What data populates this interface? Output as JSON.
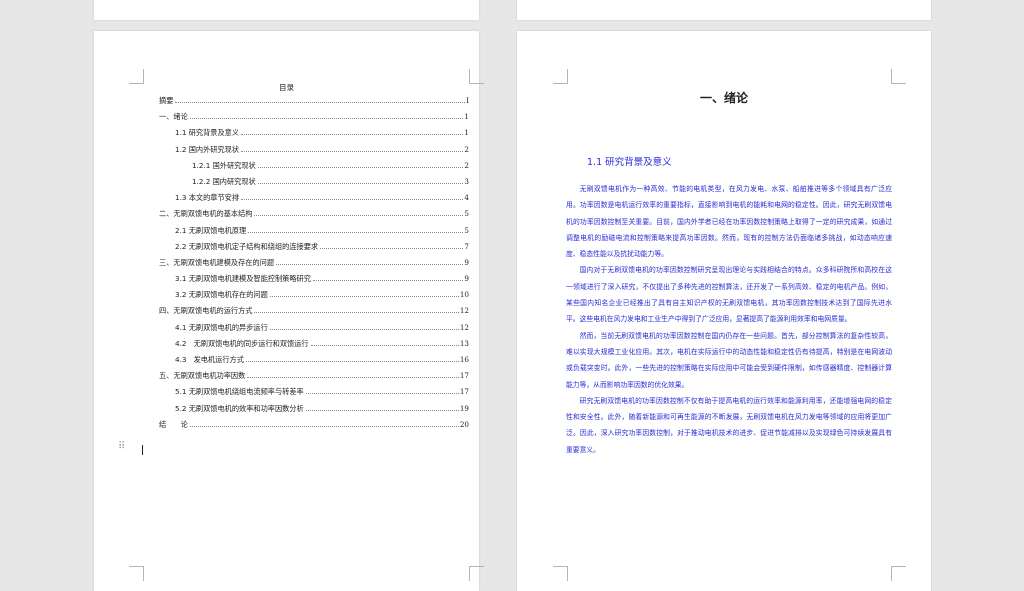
{
  "toc": {
    "title": "目录",
    "rows": [
      {
        "label": "摘要",
        "page": "I",
        "level": 0
      },
      {
        "label": "一、绪论",
        "page": "1",
        "level": 0
      },
      {
        "label": "1.1 研究背景及意义",
        "page": "1",
        "level": 1
      },
      {
        "label": "1.2 国内外研究现状",
        "page": "2",
        "level": 1
      },
      {
        "label": "1.2.1 国外研究现状",
        "page": "2",
        "level": 2
      },
      {
        "label": "1.2.2 国内研究现状",
        "page": "3",
        "level": 2
      },
      {
        "label": "1.3 本文的章节安排",
        "page": "4",
        "level": 1
      },
      {
        "label": "二、无刷双馈电机的基本结构",
        "page": "5",
        "level": 0
      },
      {
        "label": "2.1 无刷双馈电机原理",
        "page": "5",
        "level": 1
      },
      {
        "label": "2.2 无刷双馈电机定子结构和绕组的连接要求",
        "page": "7",
        "level": 1
      },
      {
        "label": "三、无刷双馈电机建模及存在的问题",
        "page": "9",
        "level": 0
      },
      {
        "label": "3.1 无刷双馈电机建模及智能控制策略研究",
        "page": "9",
        "level": 1
      },
      {
        "label": "3.2 无刷双馈电机存在的问题",
        "page": "10",
        "level": 1
      },
      {
        "label": "四、无刷双馈电机的运行方式",
        "page": "12",
        "level": 0
      },
      {
        "label": "4.1 无刷双馈电机的异步运行",
        "page": "12",
        "level": 1
      },
      {
        "label": "4.2　无刷双馈电机的同步运行和双馈运行",
        "page": "13",
        "level": 1
      },
      {
        "label": "4.3　发电机运行方式",
        "page": "16",
        "level": 1
      },
      {
        "label": "五、无刷双馈电机功率因数",
        "page": "17",
        "level": 0
      },
      {
        "label": "5.1 无刷双馈电机绕组电流频率与转差率",
        "page": "17",
        "level": 1
      },
      {
        "label": "5.2 无刷双馈电机的效率和功率因数分析",
        "page": "19",
        "level": 1
      },
      {
        "label": "结　　论",
        "page": "20",
        "level": 0
      }
    ]
  },
  "chapter": {
    "heading": "一、绪论",
    "section_heading": "1.1 研究背景及意义",
    "paragraphs": [
      "无刷双馈电机作为一种高效、节能的电机类型，在风力发电、水泵、船舶推进等多个领域具有广泛应用。功率因数是电机运行效率的重要指标，直接影响到电机的能耗和电网的稳定性。因此，研究无刷双馈电机的功率因数控制至关重要。目前，国内外学者已经在功率因数控制策略上取得了一定的研究成果，如通过调整电机的励磁电流和控制策略来提高功率因数。然而，现有的控制方法仍面临诸多挑战，如动态响应速度、稳态性能以及抗扰动能力等。",
      "国内对于无刷双馈电机的功率因数控制研究呈现出理论与实践相结合的特点。众多科研院所和高校在这一领域进行了深入研究，不仅提出了多种先进的控制算法，还开发了一系列高效、稳定的电机产品。例如，某些国内知名企业已经推出了具有自主知识产权的无刷双馈电机，其功率因数控制技术达到了国际先进水平。这些电机在风力发电和工业生产中得到了广泛应用，显著提高了能源利用效率和电网质量。",
      "然而，当前无刷双馈电机的功率因数控制在国内仍存在一些问题。首先，部分控制算法的复杂性较高，难以实现大规模工业化应用。其次，电机在实际运行中的动态性能和稳定性仍有待提高，特别是在电网波动或负载突变时。此外，一些先进的控制策略在实际应用中可能会受到硬件限制，如传感器精度、控制器计算能力等，从而影响功率因数的优化效果。",
      "研究无刷双馈电机的功率因数控制不仅有助于提高电机的运行效率和能源利用率，还能增强电网的稳定性和安全性。此外，随着新能源和可再生能源的不断发展，无刷双馈电机在风力发电等领域的应用将更加广泛。因此，深入研究功率因数控制，对于推动电机技术的进步、促进节能减排以及实现绿色可持续发展具有重要意义。"
    ]
  }
}
